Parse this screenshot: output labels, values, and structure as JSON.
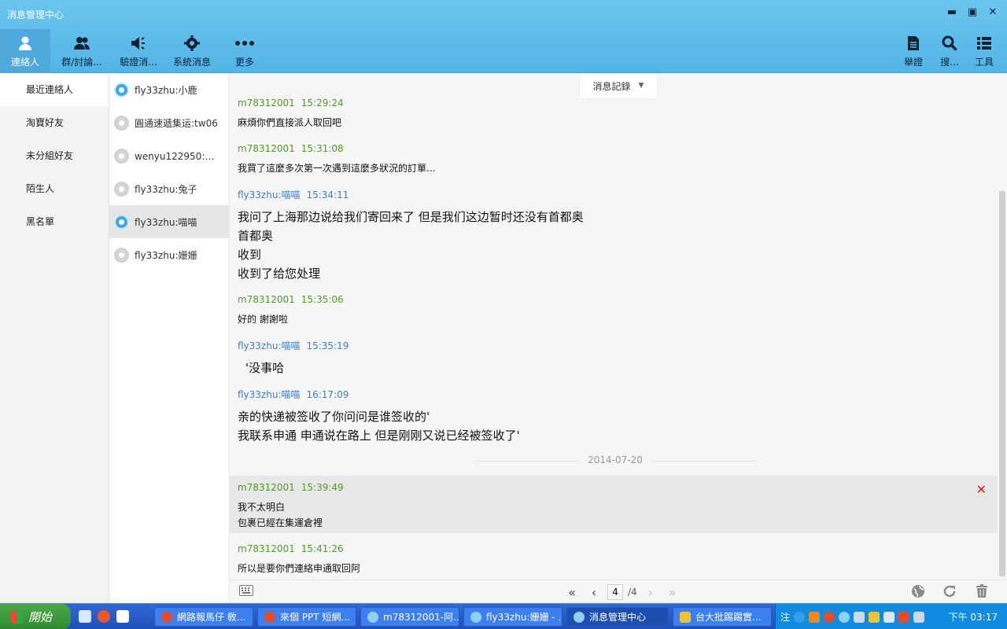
{
  "window": {
    "title": "消息管理中心"
  },
  "toolbar": {
    "items": [
      {
        "label": "連絡人",
        "icon": "person-icon"
      },
      {
        "label": "群/討論...",
        "icon": "group-icon"
      },
      {
        "label": "驗證消...",
        "icon": "speaker-icon"
      },
      {
        "label": "系統消息",
        "icon": "gear-icon"
      },
      {
        "label": "更多",
        "icon": "more-icon"
      }
    ],
    "right": [
      {
        "label": "舉證",
        "icon": "document-icon"
      },
      {
        "label": "搜...",
        "icon": "search-icon"
      },
      {
        "label": "工具",
        "icon": "tools-icon"
      }
    ]
  },
  "leftnav": {
    "items": [
      "最近連絡人",
      "淘寶好友",
      "未分組好友",
      "陌生人",
      "黑名單"
    ]
  },
  "contacts": [
    {
      "name": "fly33zhu:小鹿",
      "online": true
    },
    {
      "name": "圓通速遞集运:tw06",
      "online": false
    },
    {
      "name": "wenyu122950:乖...",
      "online": false
    },
    {
      "name": "fly33zhu:兔子",
      "online": false
    },
    {
      "name": "fly33zhu:喵喵",
      "online": true
    },
    {
      "name": "fly33zhu:姗姗",
      "online": false
    }
  ],
  "chat": {
    "filter": "消息記錄",
    "date_separator": "2014-07-20",
    "messages": [
      {
        "user": "m78312001",
        "time": "15:29:24",
        "lines": [
          "麻煩你們直接派人取回吧"
        ]
      },
      {
        "user": "m78312001",
        "time": "15:31:08",
        "lines": [
          "我買了這麼多次第一次遇到這麼多狀況的訂單..."
        ]
      },
      {
        "user": "fly33zhu:喵喵",
        "time": "15:34:11",
        "lines": [
          "我问了上海那边说给我们寄回来了 但是我们这边暂时还没有首都奥",
          "首都奥",
          "收到",
          "收到了给您处理"
        ]
      },
      {
        "user": "m78312001",
        "time": "15:35:06",
        "lines": [
          "好的 謝謝啦"
        ]
      },
      {
        "user": "fly33zhu:喵喵",
        "time": "15:35:19",
        "lines": [
          "'没事哈"
        ]
      },
      {
        "user": "fly33zhu:喵喵",
        "time": "16:17:09",
        "lines": [
          "亲的快递被签收了你问问是谁签收的'",
          "我联系申通 申通说在路上 但是刚刚又说已经被签收了'"
        ]
      },
      {
        "user": "m78312001",
        "time": "15:39:49",
        "lines": [
          "我不太明白",
          "包裹已經在集運倉裡"
        ]
      },
      {
        "user": "m78312001",
        "time": "15:41:26",
        "lines": [
          "所以是要你們連絡申通取回阿"
        ]
      }
    ]
  },
  "pager": {
    "current": "4",
    "total": "/4"
  },
  "taskbar": {
    "start": "開始",
    "tasks": [
      "網路報馬仔 敎...",
      "來個 PPT 短網...",
      "m78312001-阿...",
      "fly33zhu:姗姗 - ...",
      "消息管理中心",
      "台大批踢踢實..."
    ],
    "ime": "注",
    "clock": "下午 03:17"
  }
}
